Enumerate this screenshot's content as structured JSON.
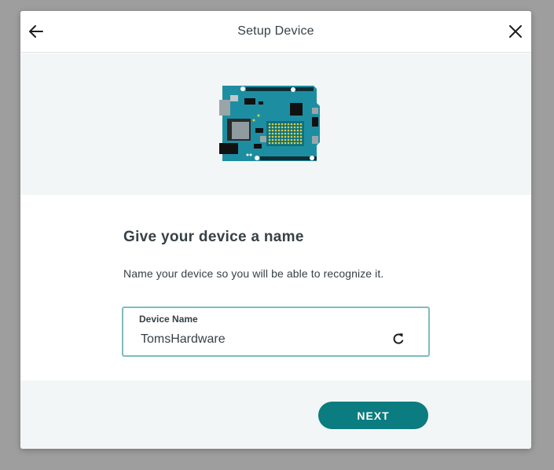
{
  "header": {
    "title": "Setup Device",
    "back_icon": "arrow-left-icon",
    "close_icon": "close-icon"
  },
  "hero": {
    "image": "arduino-board-illustration"
  },
  "main": {
    "heading": "Give your device a name",
    "description": "Name your device so you will be able to recognize it.",
    "device_name": {
      "label": "Device Name",
      "value": "TomsHardware",
      "refresh_icon": "refresh-icon"
    }
  },
  "footer": {
    "next_label": "NEXT"
  },
  "colors": {
    "accent": "#0b7c7f",
    "field_border": "#7fbcbe",
    "text": "#374146",
    "panel_bg": "#f3f6f6",
    "board": "#1d8ea1"
  }
}
